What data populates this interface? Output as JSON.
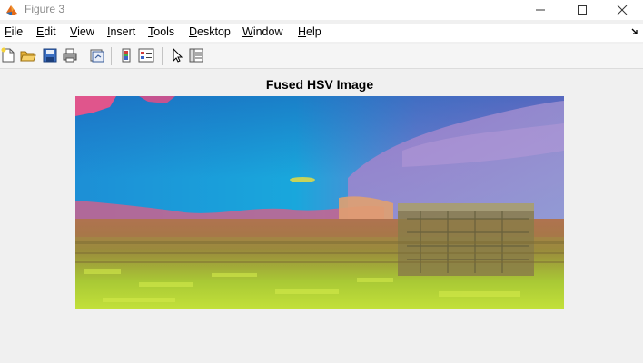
{
  "window": {
    "title": "Figure 3"
  },
  "menu": {
    "items": [
      {
        "label": "File",
        "key": "F",
        "rest": "ile"
      },
      {
        "label": "Edit",
        "key": "E",
        "rest": "dit"
      },
      {
        "label": "View",
        "key": "V",
        "rest": "iew"
      },
      {
        "label": "Insert",
        "key": "I",
        "rest": "nsert"
      },
      {
        "label": "Tools",
        "key": "T",
        "rest": "ools"
      },
      {
        "label": "Desktop",
        "key": "D",
        "rest": "esktop"
      },
      {
        "label": "Window",
        "key": "W",
        "rest": "indow"
      },
      {
        "label": "Help",
        "key": "H",
        "rest": "elp"
      }
    ]
  },
  "toolbar": {
    "buttons": [
      "new-figure-icon",
      "open-folder-icon",
      "save-icon",
      "print-icon",
      "link-plot-icon",
      "colorbar-icon",
      "legend-icon",
      "edit-plot-pointer-icon",
      "property-inspector-icon"
    ]
  },
  "axes": {
    "title": "Fused HSV Image"
  },
  "colors": {
    "sky_blue": "#1b9fd8",
    "sky_violet": "#8a6fc4",
    "ground_green": "#a8d42a",
    "ground_olive": "#8c7a3a",
    "magenta": "#e0558c"
  }
}
